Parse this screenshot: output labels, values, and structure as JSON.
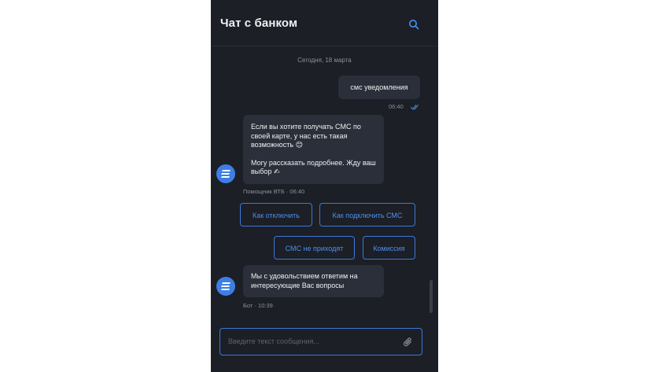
{
  "header": {
    "title": "Чат с банком",
    "search_icon": "search-icon"
  },
  "chat": {
    "date_separator": "Сегодня, 18 марта",
    "user_message": {
      "text": "смс уведомления",
      "time": "06:40"
    },
    "bot_message_1": {
      "paragraph_1": "Если вы хотите получать СМС по своей карте, у нас есть такая возможность 😊",
      "paragraph_2": "Могу рассказать подробнее. Жду ваш выбор ✍",
      "meta": "Помощник ВТБ · 06:40"
    },
    "quick_replies": [
      "Как отключить",
      "Как подключить СМС",
      "СМС не приходят",
      "Комиссия"
    ],
    "bot_message_2": {
      "text": "Мы с удовольствием ответим на интересующие Вас вопросы",
      "meta": "Бот · 10:39"
    }
  },
  "composer": {
    "placeholder": "Введите текст сообщения...",
    "attach_icon": "paperclip-icon"
  },
  "colors": {
    "background": "#1c1f26",
    "bubble": "#2b2f39",
    "accent": "#3b78dc",
    "avatar": "#3d7fe6"
  }
}
